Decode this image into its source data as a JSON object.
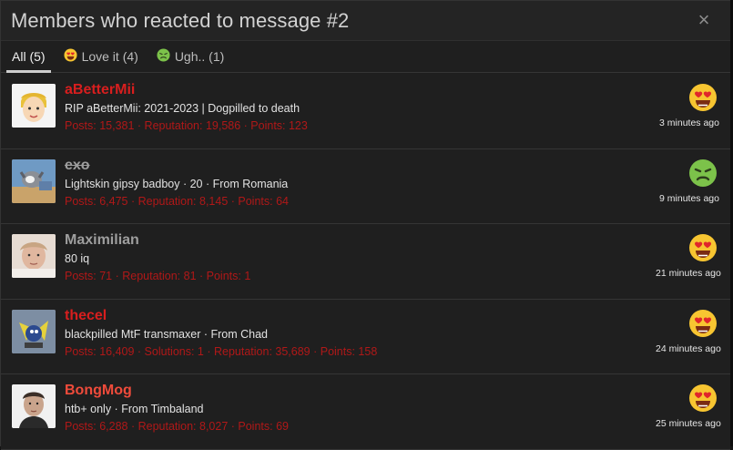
{
  "overlay": {
    "title": "Members who reacted to message #2",
    "close_icon": "×"
  },
  "tabs": [
    {
      "label": "All (5)",
      "icon": null
    },
    {
      "label": "Love it (4)",
      "icon": "love-emoji-icon"
    },
    {
      "label": "Ugh.. (1)",
      "icon": "sick-emoji-icon"
    }
  ],
  "members": [
    {
      "name": "aBetterMii",
      "signature": "RIP aBetterMii: 2021-2023 | Dogpilled to death",
      "stats": "Posts: 15,381 · Reputation: 19,586 · Points: 123",
      "reaction": "love",
      "time": "3 minutes ago"
    },
    {
      "name": "exo",
      "signature": "Lightskin gipsy badboy · 20 · From Romania",
      "stats": "Posts: 6,475 · Reputation: 8,145 · Points: 64",
      "reaction": "sick",
      "time": "9 minutes ago"
    },
    {
      "name": "Maximilian",
      "signature": "80 iq",
      "stats": "Posts: 71 · Reputation: 81 · Points: 1",
      "reaction": "love",
      "time": "21 minutes ago"
    },
    {
      "name": "thecel",
      "signature": "blackpilled MtF transmaxer · From Chad",
      "stats": "Posts: 16,409 · Solutions: 1 · Reputation: 35,689 · Points: 158",
      "reaction": "love",
      "time": "24 minutes ago"
    },
    {
      "name": "BongMog",
      "signature": "htb+ only · From Timbaland",
      "stats": "Posts: 6,288 · Reputation: 8,027 · Points: 69",
      "reaction": "love",
      "time": "25 minutes ago"
    }
  ],
  "colors": {
    "username_red": "#d81e1e",
    "stats_red": "#b01818",
    "love_face": "#f7c531",
    "sick_face": "#7cc24a"
  }
}
